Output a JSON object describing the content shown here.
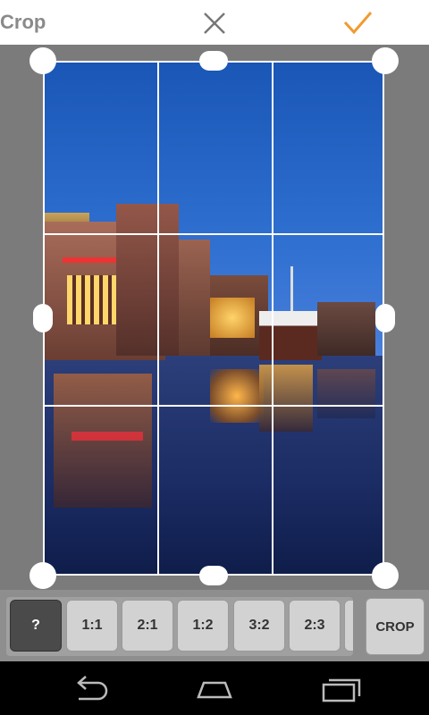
{
  "header": {
    "title": "Crop",
    "close_icon": "close-icon",
    "confirm_icon": "check-icon",
    "confirm_color": "#f29a30"
  },
  "ratios": [
    {
      "label": "?",
      "active": true
    },
    {
      "label": "1:1",
      "active": false
    },
    {
      "label": "2:1",
      "active": false
    },
    {
      "label": "1:2",
      "active": false
    },
    {
      "label": "3:2",
      "active": false
    },
    {
      "label": "2:3",
      "active": false
    }
  ],
  "crop_button": {
    "label": "CROP"
  },
  "navbar": {
    "back_icon": "back-icon",
    "home_icon": "home-icon",
    "recents_icon": "recents-icon"
  }
}
